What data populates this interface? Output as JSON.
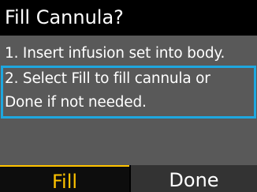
{
  "title": "Fill Cannula?",
  "message": {
    "line1": "1. Insert infusion set into body.",
    "line2": "2. Select Fill to fill cannula or",
    "line3": "Done if not needed."
  },
  "softkeys": {
    "left_label": "Fill",
    "right_label": "Done"
  },
  "colors": {
    "selection": "#1ea7df",
    "active_softkey": "#ffc300",
    "content_bg": "#595959"
  }
}
